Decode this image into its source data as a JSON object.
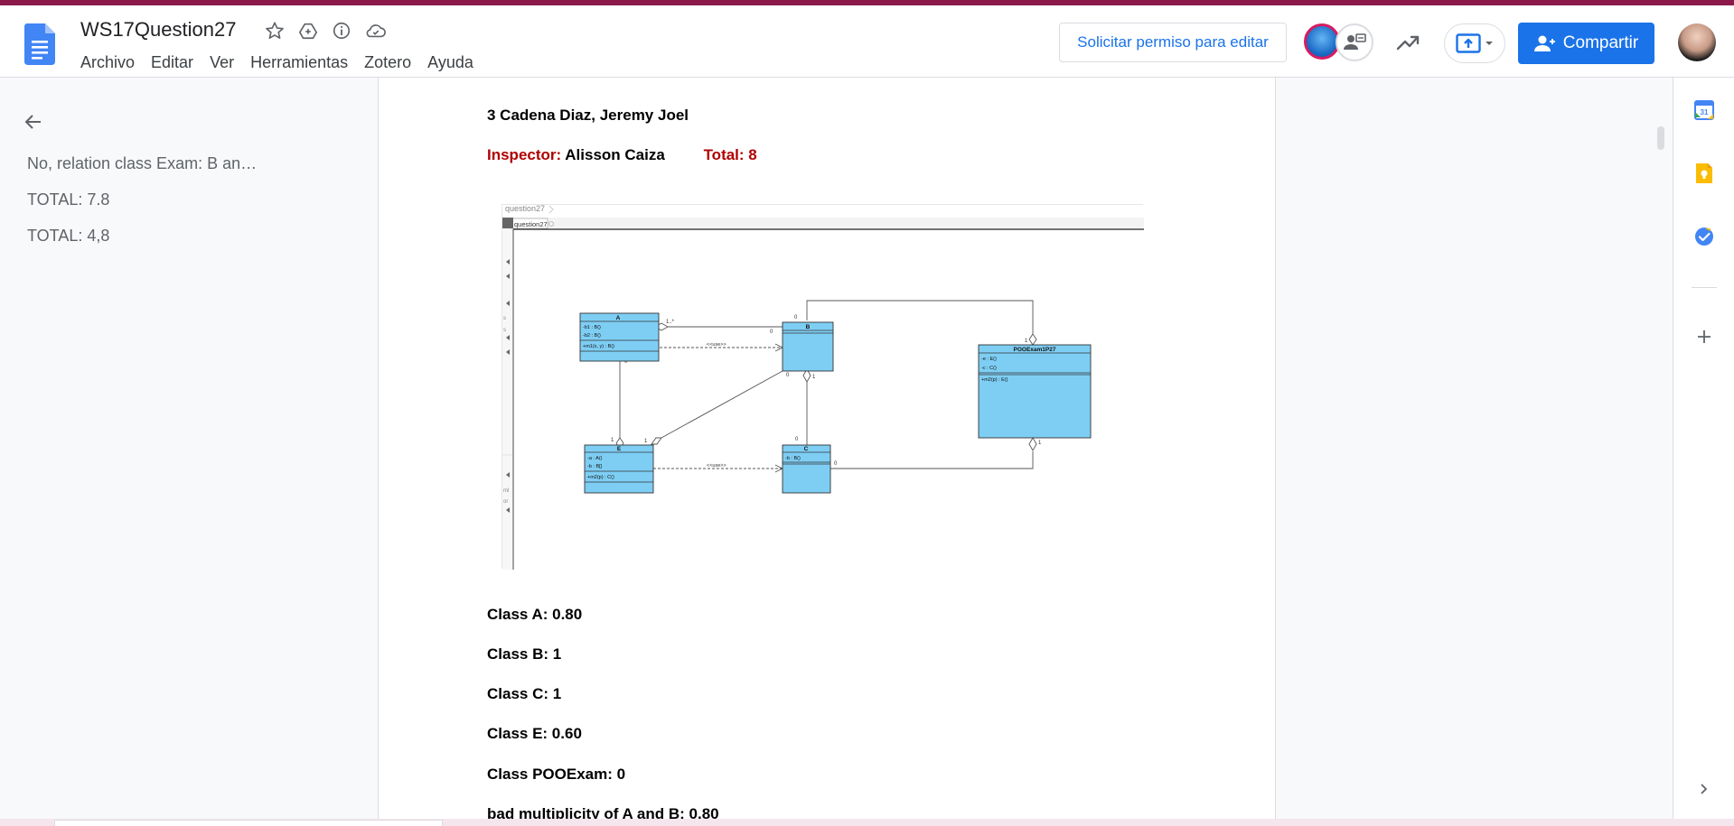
{
  "header": {
    "doc_title": "WS17Question27",
    "menu": [
      "Archivo",
      "Editar",
      "Ver",
      "Herramientas",
      "Zotero",
      "Ayuda"
    ],
    "request_edit_label": "Solicitar permiso para editar",
    "share_label": "Compartir"
  },
  "outline": {
    "items": [
      "No, relation class Exam: B an…",
      "TOTAL: 7.8",
      "TOTAL: 4,8"
    ]
  },
  "document": {
    "student_line": "3 Cadena Diaz, Jeremy Joel",
    "inspector_label": "Inspector:",
    "inspector_name": "Alisson Caiza",
    "total_label": "Total: 8",
    "grades": [
      "Class A: 0.80",
      "Class B: 1",
      "Class C: 1",
      "Class E: 0.60",
      "Class POOExam: 0",
      "bad multiplicity of A and B: 0.80"
    ]
  },
  "diagram": {
    "breadcrumb": "question27",
    "tab_label": "question27",
    "class_a": {
      "name": "A",
      "attrs": [
        "-b1 : B()",
        "-b2 : B()"
      ],
      "ops": [
        "+m1(x, y) : B()"
      ]
    },
    "class_b": {
      "name": "B"
    },
    "class_c": {
      "name": "C",
      "attrs": [
        "-b : B()"
      ]
    },
    "class_e": {
      "name": "E",
      "attrs": [
        "-a : A()",
        "-b : B[]"
      ],
      "ops": [
        "+m2(p) : C()"
      ]
    },
    "class_poo": {
      "name": "POOExam1P27",
      "attrs": [
        "-e : E()",
        "-c : C()"
      ],
      "ops": [
        "+m2(p) : E()"
      ]
    },
    "use_label": "<<use>>",
    "multiplicities": {
      "a_b_a_end": "1..*",
      "a_b_b_end": "0",
      "b_top": "0",
      "poo_top": "1",
      "a_bottom": "0",
      "e_top": "1",
      "e_right": "1",
      "b_bottom_left": "0",
      "b_bottom_right": "1",
      "c_top": "0",
      "c_right": "0",
      "poo_bottom": "1"
    }
  },
  "colors": {
    "accent_strip": "#8b1a4a",
    "share_button": "#1a73e8",
    "inspector_red": "#b00000",
    "uml_fill": "#7ecef4"
  }
}
